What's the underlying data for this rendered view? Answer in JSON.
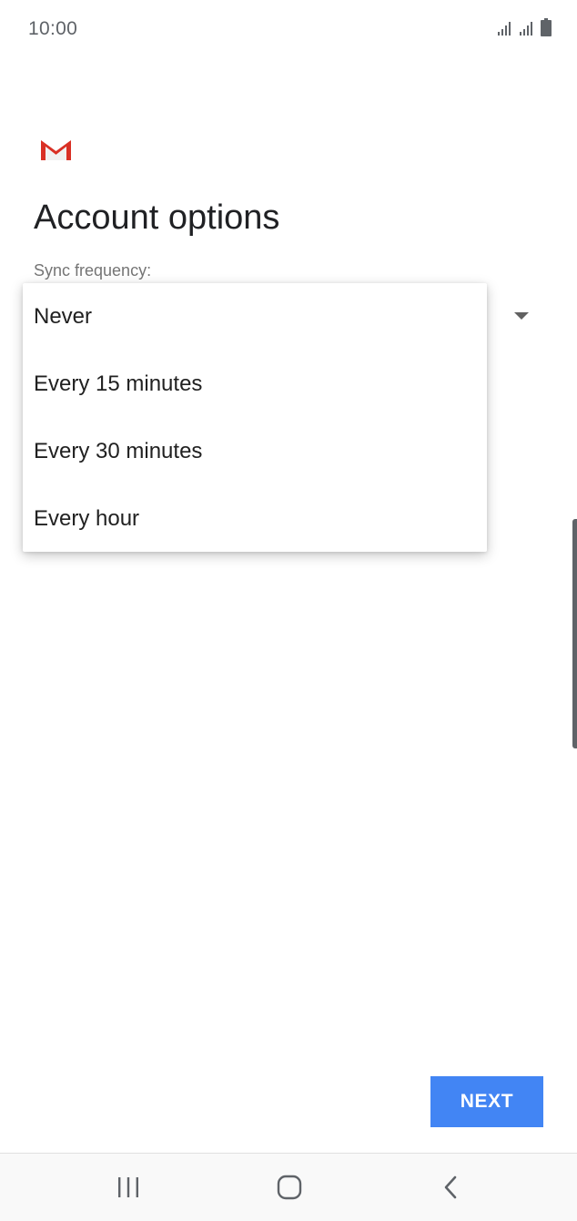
{
  "status_bar": {
    "time": "10:00",
    "icons": [
      "signal-icon",
      "signal-icon",
      "battery-icon"
    ]
  },
  "app": {
    "logo": "gmail-logo-icon"
  },
  "page": {
    "title": "Account options",
    "sync_label": "Sync frequency:"
  },
  "dropdown": {
    "options": [
      "Never",
      "Every 15 minutes",
      "Every 30 minutes",
      "Every hour"
    ]
  },
  "actions": {
    "next_label": "NEXT"
  },
  "nav_bar": {
    "icons": [
      "recent-apps-icon",
      "home-icon",
      "back-icon"
    ]
  },
  "colors": {
    "accent": "#4285f4",
    "gmail_red": "#d93025"
  }
}
